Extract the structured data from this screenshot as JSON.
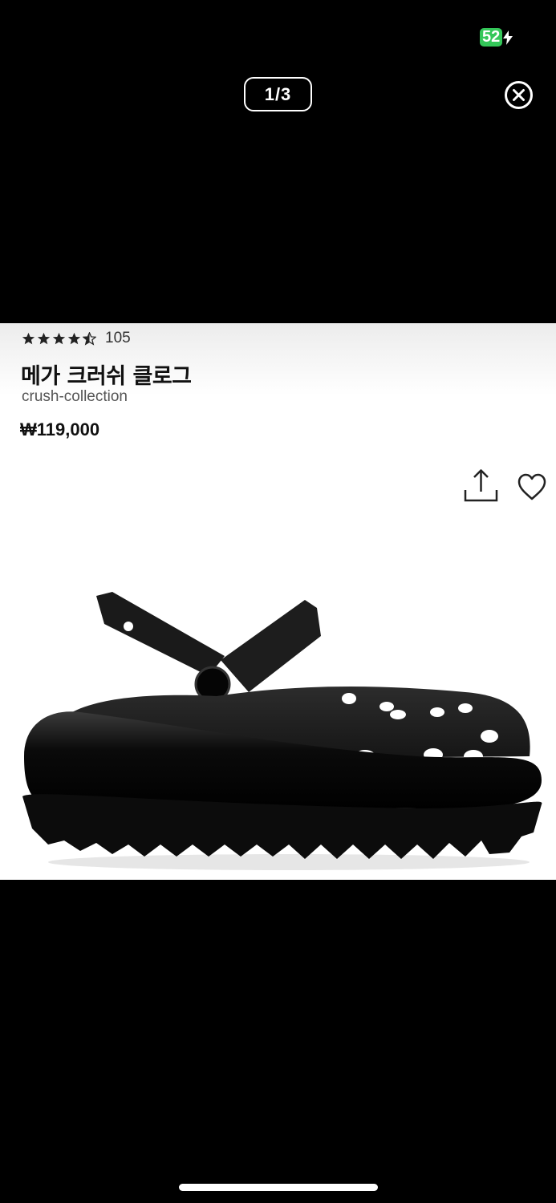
{
  "status_bar": {
    "battery_level": "52"
  },
  "viewer": {
    "counter_current": "1",
    "counter_total": "3",
    "counter_text": "1/3"
  },
  "product": {
    "rating_value": 4.5,
    "rating_max": 5,
    "review_count": "105",
    "title": "메가 크러쉬 클로그",
    "collection": "crush-collection",
    "price": "₩119,000"
  },
  "icons": {
    "close": "close-circle-icon",
    "share": "share-icon",
    "favorite": "heart-outline-icon",
    "battery_charging": "bolt-icon"
  },
  "colors": {
    "battery_green": "#34c759",
    "background": "#000000",
    "image_background": "#ffffff"
  }
}
